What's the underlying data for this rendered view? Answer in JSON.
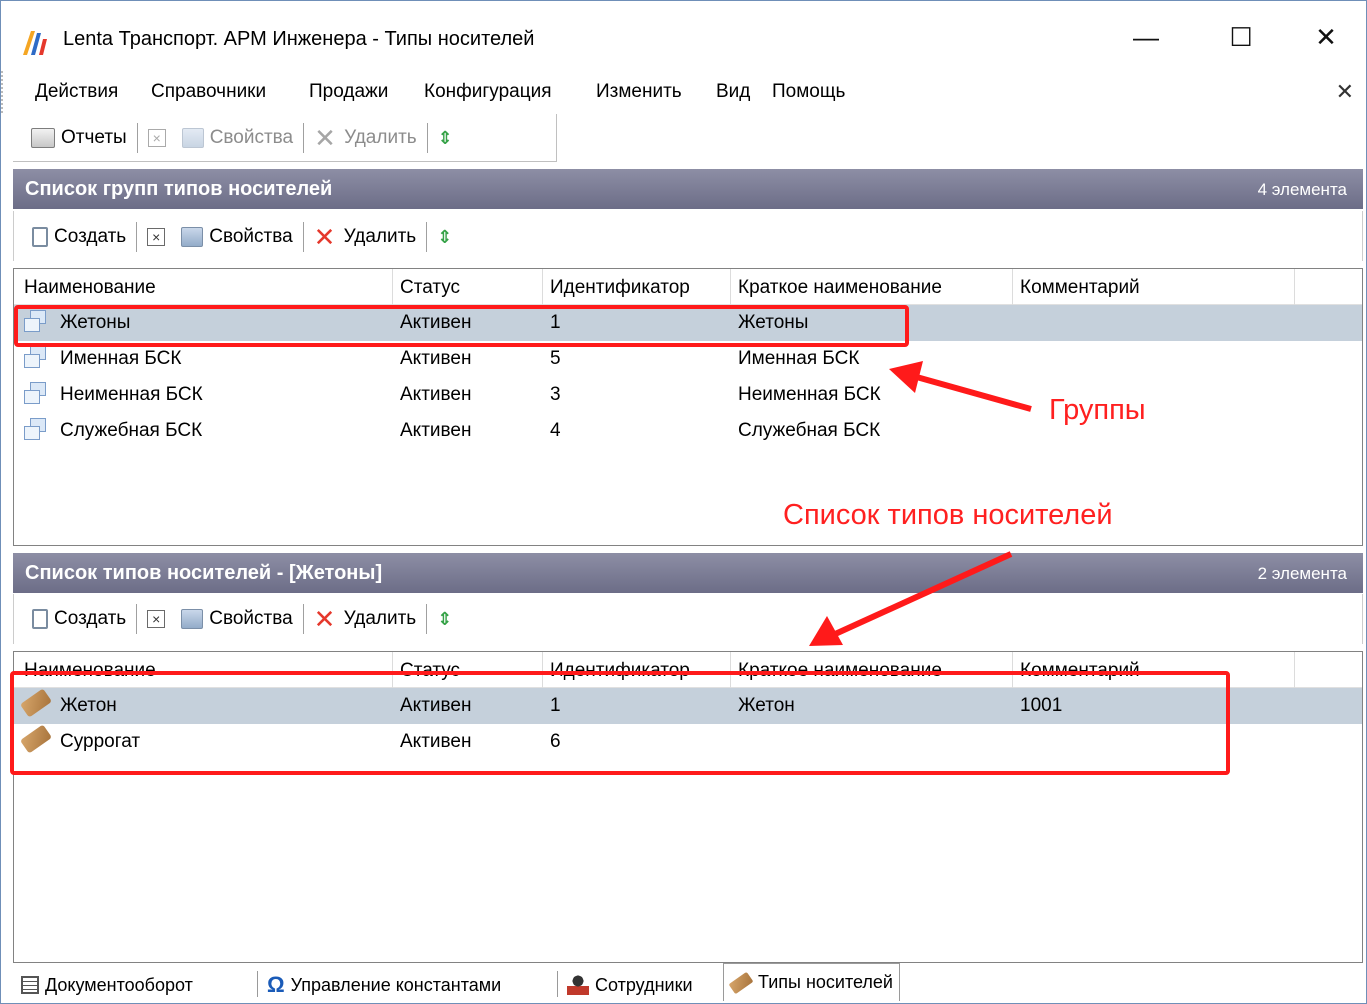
{
  "window": {
    "title": "Lenta Транспорт. АРМ Инженера - Типы носителей",
    "min_glyph": "—",
    "max_glyph": "☐",
    "close_glyph": "✕"
  },
  "menu": {
    "items": [
      "Действия",
      "Справочники",
      "Продажи",
      "Конфигурация",
      "Изменить",
      "Вид",
      "Помощь"
    ],
    "close_glyph": "✕"
  },
  "main_toolbar": {
    "reports_label": "Отчеты",
    "properties_label": "Свойства",
    "delete_label": "Удалить"
  },
  "groups_panel": {
    "title": "Список групп типов носителей",
    "count": "4 элемента",
    "toolbar": {
      "create_label": "Создать",
      "properties_label": "Свойства",
      "delete_label": "Удалить"
    },
    "columns": [
      "Наименование",
      "Статус",
      "Идентификатор",
      "Краткое наименование",
      "Комментарий"
    ],
    "rows": [
      [
        "Жетоны",
        "Активен",
        "1",
        "Жетоны",
        ""
      ],
      [
        "Именная БСК",
        "Активен",
        "5",
        "Именная БСК",
        ""
      ],
      [
        "Неименная БСК",
        "Активен",
        "3",
        "Неименная БСК",
        ""
      ],
      [
        "Служебная БСК",
        "Активен",
        "4",
        "Служебная БСК",
        ""
      ]
    ]
  },
  "types_panel": {
    "title": "Список типов носителей - [Жетоны]",
    "count": "2 элемента",
    "toolbar": {
      "create_label": "Создать",
      "properties_label": "Свойства",
      "delete_label": "Удалить"
    },
    "columns": [
      "Наименование",
      "Статус",
      "Идентификатор",
      "Краткое наименование",
      "Комментарий"
    ],
    "rows": [
      [
        "Жетон",
        "Активен",
        "1",
        "Жетон",
        "1001"
      ],
      [
        "Суррогат",
        "Активен",
        "6",
        "",
        ""
      ]
    ]
  },
  "annotations": {
    "groups_label": "Группы",
    "types_label": "Список типов носителей",
    "color": "#ff1a1a"
  },
  "tabs": [
    "Документооборот",
    "Управление константами",
    "Сотрудники",
    "Типы носителей"
  ],
  "colors": {
    "header_bg": "#7d7e98",
    "selected_row": "#c5d0db"
  }
}
